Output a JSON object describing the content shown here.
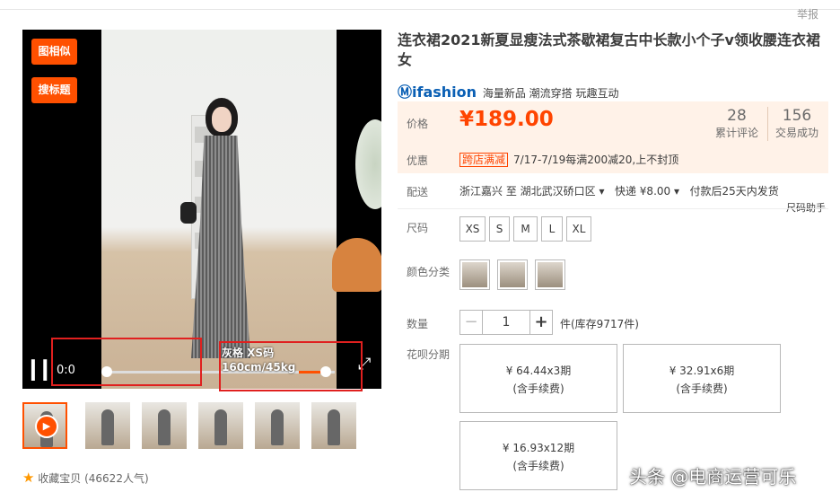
{
  "report_link": "举报",
  "product": {
    "title": "连衣裙2021新夏显瘦法式茶歇裙复古中长款小个子v领收腰连衣裙女",
    "brand_logo": "Ⓜifashion",
    "brand_tagline": "海量新品 潮流穿搭 玩趣互动"
  },
  "media": {
    "tag_buttons": [
      "图相似",
      "搜标题"
    ],
    "time_display": "0:0",
    "size_overlay_line1": "灰格 XS码",
    "size_overlay_line2": "160cm/45kg",
    "progress_fraction": 0.96,
    "thumbnail_count": 6
  },
  "price": {
    "label": "价格",
    "value": "¥189.00",
    "reviews_count": "28",
    "reviews_label": "累计评论",
    "sales_count": "156",
    "sales_label": "交易成功"
  },
  "promo": {
    "label": "优惠",
    "tag": "跨店满减",
    "text": "7/17-7/19每满200减20,上不封顶"
  },
  "shipping": {
    "label": "配送",
    "from": "浙江嘉兴 至",
    "to": "湖北武汉硚口区",
    "method": "快递 ¥8.00",
    "time": "付款后25天内发货",
    "size_helper": "尺码助手"
  },
  "size": {
    "label": "尺码",
    "options": [
      "XS",
      "S",
      "M",
      "L",
      "XL"
    ]
  },
  "color": {
    "label": "颜色分类",
    "swatch_count": 3
  },
  "quantity": {
    "label": "数量",
    "value": "1",
    "minus": "−",
    "plus": "+",
    "stock": "件(库存9717件)"
  },
  "installments": {
    "label": "花呗分期",
    "options": [
      {
        "amount": "¥ 64.44x3期",
        "fee": "(含手续费)"
      },
      {
        "amount": "¥ 32.91x6期",
        "fee": "(含手续费)"
      },
      {
        "amount": "¥ 16.93x12期",
        "fee": "(含手续费)"
      }
    ]
  },
  "favorite": {
    "star": "★",
    "text": "收藏宝贝 (46622人气)"
  },
  "watermark": "头条 @电商运营可乐",
  "colors": {
    "accent": "#ff5000",
    "price": "#ff4400",
    "price_bg": "#fff2e8",
    "highlight_box": "#e0201f"
  }
}
